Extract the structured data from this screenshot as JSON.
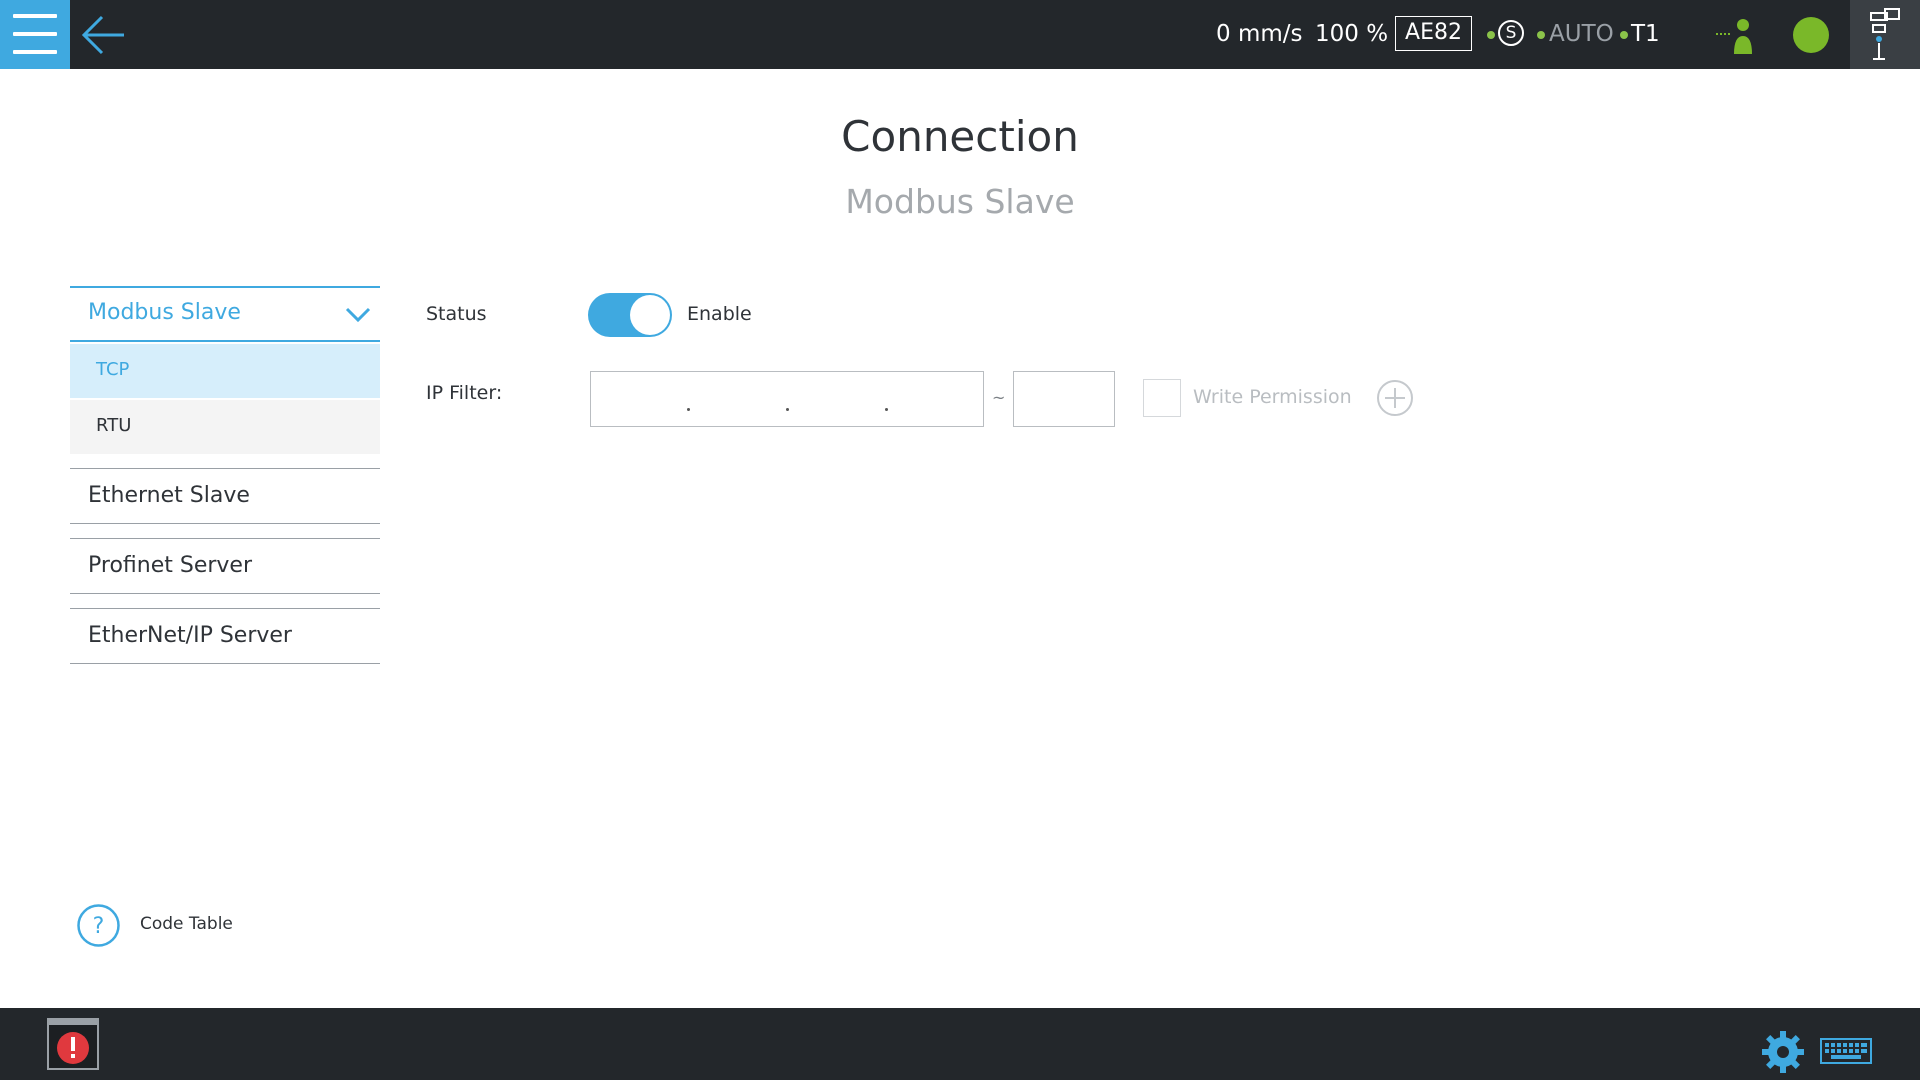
{
  "header": {
    "speed": "0 mm/s",
    "override": "100 %",
    "controller_id": "AE82",
    "safety_symbol": "S",
    "mode": "AUTO",
    "operating_mode": "T1",
    "status_color": "#7ab829",
    "accent_color": "#3fa9e0"
  },
  "page": {
    "title": "Connection",
    "subtitle": "Modbus Slave"
  },
  "sidebar": {
    "group_label": "Modbus Slave",
    "sub_items": [
      {
        "label": "TCP",
        "active": true
      },
      {
        "label": "RTU",
        "active": false
      }
    ],
    "items": [
      {
        "label": "Ethernet Slave"
      },
      {
        "label": "Profinet Server"
      },
      {
        "label": "EtherNet/IP Server"
      }
    ]
  },
  "form": {
    "status_label": "Status",
    "status_value": "Enable",
    "status_enabled": true,
    "ip_filter_label": "IP Filter:",
    "ip_value": "",
    "range_separator": "~",
    "range_end_value": "",
    "write_permission_label": "Write Permission",
    "write_permission_checked": false
  },
  "footer": {
    "code_table_label": "Code Table"
  },
  "icons": [
    "menu-icon",
    "back-arrow-icon",
    "safety-s-icon",
    "user-status-icon",
    "robot-arm-icon",
    "chevron-down-icon",
    "plus-circle-icon",
    "question-icon",
    "alert-icon",
    "gear-icon",
    "keyboard-icon"
  ]
}
